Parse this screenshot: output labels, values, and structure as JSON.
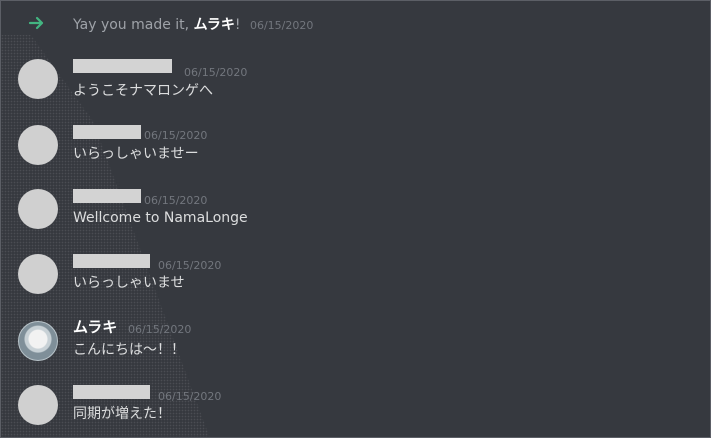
{
  "colors": {
    "background": "#36393f",
    "join_arrow": "#43b581",
    "author_name": "#ffffff",
    "timestamp": "#72767d",
    "message_text": "#dcddde",
    "redaction_block": "#d3d3d3"
  },
  "system_message": {
    "icon": "join-arrow-icon",
    "prefix": "Yay you made it, ",
    "user": "ムラキ",
    "suffix": "!",
    "time": "06/15/2020"
  },
  "messages": [
    {
      "author": "",
      "author_redacted": true,
      "time": "06/15/2020",
      "text": "ようこそナマロンゲへ",
      "avatar": "placeholder-avatar"
    },
    {
      "author": "",
      "author_redacted": true,
      "time": "06/15/2020",
      "text": "いらっしゃいませー",
      "avatar": "placeholder-avatar"
    },
    {
      "author": "",
      "author_redacted": true,
      "time": "06/15/2020",
      "text": "Wellcome to NamaLonge",
      "avatar": "placeholder-avatar"
    },
    {
      "author": "",
      "author_redacted": true,
      "time": "06/15/2020",
      "text": "いらっしゃいませ",
      "avatar": "placeholder-avatar"
    },
    {
      "author": "ムラキ",
      "author_redacted": false,
      "time": "06/15/2020",
      "text": "こんにちは〜！！",
      "avatar": "user-avatar-image"
    },
    {
      "author": "",
      "author_redacted": true,
      "time": "06/15/2020",
      "text": "同期が増えた！",
      "avatar": "placeholder-avatar"
    }
  ]
}
